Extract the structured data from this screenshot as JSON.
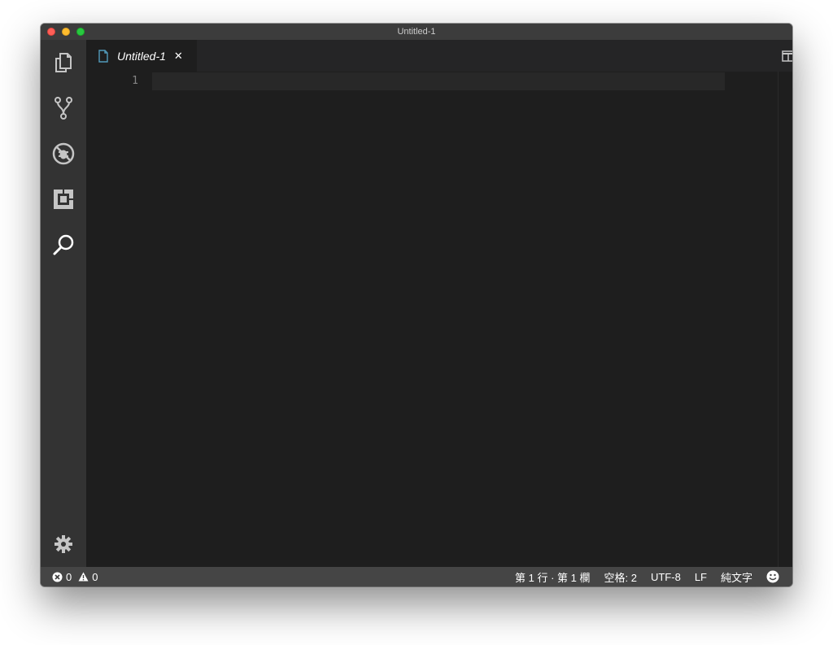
{
  "window": {
    "title": "Untitled-1"
  },
  "activity_bar": {
    "items": [
      {
        "icon": "files-icon",
        "label": "Explorer"
      },
      {
        "icon": "source-control-icon",
        "label": "Source Control"
      },
      {
        "icon": "debug-icon",
        "label": "Debug"
      },
      {
        "icon": "extensions-icon",
        "label": "Extensions"
      },
      {
        "icon": "search-icon",
        "label": "Search"
      }
    ],
    "settings_icon": "gear-icon"
  },
  "tabs": [
    {
      "label": "Untitled-1",
      "icon": "file-icon",
      "active": true,
      "italic": true
    }
  ],
  "editor": {
    "line_numbers": [
      "1"
    ],
    "content": ""
  },
  "status_bar": {
    "errors": "0",
    "warnings": "0",
    "position": "第 1 行 · 第 1 欄",
    "indentation": "空格: 2",
    "encoding": "UTF-8",
    "line_ending": "LF",
    "language": "純文字"
  },
  "colors": {
    "activity_bar_bg": "#333333",
    "editor_bg": "#1e1e1e",
    "tabs_bg": "#252526",
    "status_bar_bg": "#454545",
    "file_icon": "#519aba"
  }
}
